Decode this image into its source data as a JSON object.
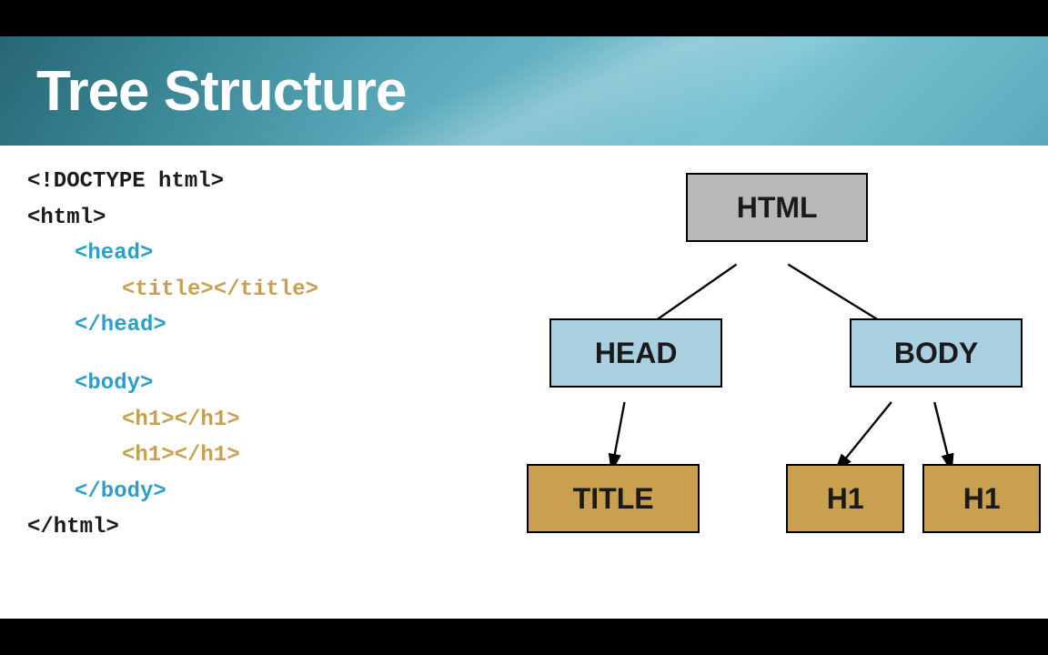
{
  "title": "Tree Structure",
  "code": {
    "doctype": "<!DOCTYPE html>",
    "html_open": "<html>",
    "head_open": "<head>",
    "title_tag": "<title></title>",
    "head_close": "</head>",
    "body_open": "<body>",
    "h1_tag_a": "<h1></h1>",
    "h1_tag_b": "<h1></h1>",
    "body_close": "</body>",
    "html_close": "</html>"
  },
  "tree": {
    "root": "HTML",
    "head": "HEAD",
    "body": "BODY",
    "title": "TITLE",
    "h1a": "H1",
    "h1b": "H1"
  }
}
